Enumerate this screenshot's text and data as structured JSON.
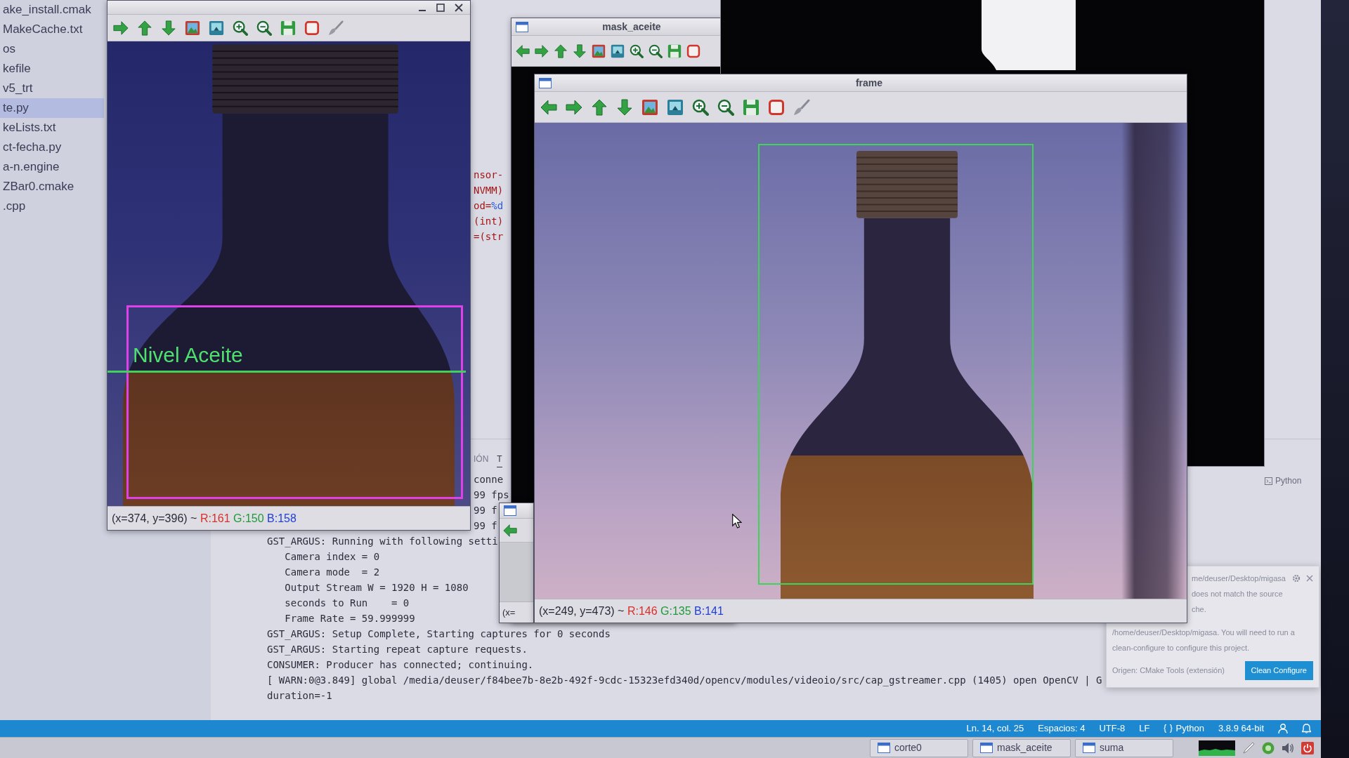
{
  "explorer": {
    "items": [
      {
        "label": "ake_install.cmak",
        "selected": false
      },
      {
        "label": "MakeCache.txt",
        "selected": false
      },
      {
        "label": "os",
        "selected": false
      },
      {
        "label": "kefile",
        "selected": false
      },
      {
        "label": "v5_trt",
        "selected": false
      },
      {
        "label": "te.py",
        "selected": true
      },
      {
        "label": "keLists.txt",
        "selected": false
      },
      {
        "label": "ct-fecha.py",
        "selected": false
      },
      {
        "label": "a-n.engine",
        "selected": false
      },
      {
        "label": "ZBar0.cmake",
        "selected": false
      },
      {
        "label": ".cpp",
        "selected": false
      }
    ]
  },
  "level_window": {
    "toolbar": [
      {
        "kind": "right"
      },
      {
        "kind": "up"
      },
      {
        "kind": "down"
      },
      {
        "kind": "image"
      },
      {
        "kind": "screen"
      },
      {
        "kind": "zoom_in"
      },
      {
        "kind": "zoom_out"
      },
      {
        "kind": "save"
      },
      {
        "kind": "properties"
      },
      {
        "kind": "brush"
      }
    ],
    "overlay_label": "Nivel Aceite",
    "status": {
      "position": "(x=374, y=396) ~",
      "r": "R:161",
      "g": "G:150",
      "b": "B:158"
    }
  },
  "editor": {
    "code_lines": [
      {
        "segments": [
          {
            "text": "nsor-",
            "kind": "string"
          }
        ]
      },
      {
        "segments": [
          {
            "text": "NVMM)",
            "kind": "string"
          }
        ]
      },
      {
        "segments": [
          {
            "text": "od=",
            "kind": "string"
          },
          {
            "text": "%d",
            "kind": "format"
          }
        ]
      },
      {
        "segments": [
          {
            "text": "(int)",
            "kind": "string"
          }
        ]
      },
      {
        "segments": [
          {
            "text": "=(str",
            "kind": "string"
          }
        ]
      }
    ]
  },
  "mask_aceite_window": {
    "title": "mask_aceite",
    "toolbar": [
      {
        "kind": "left"
      },
      {
        "kind": "right"
      },
      {
        "kind": "up"
      },
      {
        "kind": "down"
      },
      {
        "kind": "image"
      },
      {
        "kind": "screen"
      },
      {
        "kind": "zoom_in"
      },
      {
        "kind": "zoom_out"
      },
      {
        "kind": "save"
      },
      {
        "kind": "properties"
      }
    ]
  },
  "frame_window": {
    "title": "frame",
    "toolbar": [
      {
        "kind": "left"
      },
      {
        "kind": "right"
      },
      {
        "kind": "up"
      },
      {
        "kind": "down"
      },
      {
        "kind": "image"
      },
      {
        "kind": "screen"
      },
      {
        "kind": "zoom_in"
      },
      {
        "kind": "zoom_out"
      },
      {
        "kind": "save"
      },
      {
        "kind": "properties"
      },
      {
        "kind": "brush"
      }
    ],
    "status": {
      "position": "(x=249, y=473) ~",
      "r": "R:146",
      "g": "G:135",
      "b": "B:141"
    }
  },
  "small_window": {
    "toolbar": [
      {
        "kind": "left"
      }
    ],
    "status": {
      "position": "(x="
    }
  },
  "panel": {
    "tabs": [
      {
        "label": "IÓN",
        "selected": false
      },
      {
        "label": "T",
        "selected": true
      }
    ],
    "terminal_list": [
      {
        "label": "Python"
      }
    ]
  },
  "terminal": {
    "lines": [
      {
        "text": "conne",
        "kind": "clipped"
      },
      {
        "text": "99 fps",
        "kind": "clipped"
      },
      {
        "text": "99 f",
        "kind": "clipped"
      },
      {
        "text": "99 f",
        "kind": "clipped"
      },
      {
        "text": "GST_ARGUS: Running with following setti",
        "kind": "full"
      },
      {
        "text": "   Camera index = 0",
        "kind": "full"
      },
      {
        "text": "   Camera mode  = 2",
        "kind": "full"
      },
      {
        "text": "   Output Stream W = 1920 H = 1080",
        "kind": "full"
      },
      {
        "text": "   seconds to Run    = 0",
        "kind": "full"
      },
      {
        "text": "   Frame Rate = 59.999999",
        "kind": "full"
      },
      {
        "text": "GST_ARGUS: Setup Complete, Starting captures for 0 seconds",
        "kind": "full"
      },
      {
        "text": "GST_ARGUS: Starting repeat capture requests.",
        "kind": "full"
      },
      {
        "text": "CONSUMER: Producer has connected; continuing.",
        "kind": "full"
      },
      {
        "text": "[ WARN:0@3.849] global /media/deuser/f84bee7b-8e2b-492f-9cdc-15323efd340d/opencv/modules/videoio/src/cap_gstreamer.cpp (1405) open OpenCV | G",
        "kind": "full"
      },
      {
        "text": "duration=-1",
        "kind": "full"
      }
    ]
  },
  "notification": {
    "lines": [
      {
        "text": "me/deuser/Desktop/migasa",
        "kind": "clipped"
      },
      {
        "text": "does not match the source",
        "kind": "clipped"
      },
      {
        "text": "che.",
        "kind": "clipped"
      },
      {
        "text": "/home/deuser/Desktop/migasa. You will need to run a",
        "kind": "full"
      },
      {
        "text": "clean-configure to configure this project.",
        "kind": "full"
      }
    ],
    "source": "Origen: CMake Tools (extensión)",
    "button": "Clean Configure"
  },
  "status_bar": {
    "items": [
      {
        "text": "Ln. 14, col. 25",
        "kind": "text"
      },
      {
        "text": "Espacios: 4",
        "kind": "text"
      },
      {
        "text": "UTF-8",
        "kind": "text"
      },
      {
        "text": "LF",
        "kind": "text"
      },
      {
        "text": "Python",
        "kind": "language"
      },
      {
        "text": "3.8.9 64-bit",
        "kind": "text"
      }
    ]
  },
  "taskbar": {
    "items": [
      {
        "label": "corte0"
      },
      {
        "label": "mask_aceite"
      },
      {
        "label": "suma"
      }
    ]
  }
}
